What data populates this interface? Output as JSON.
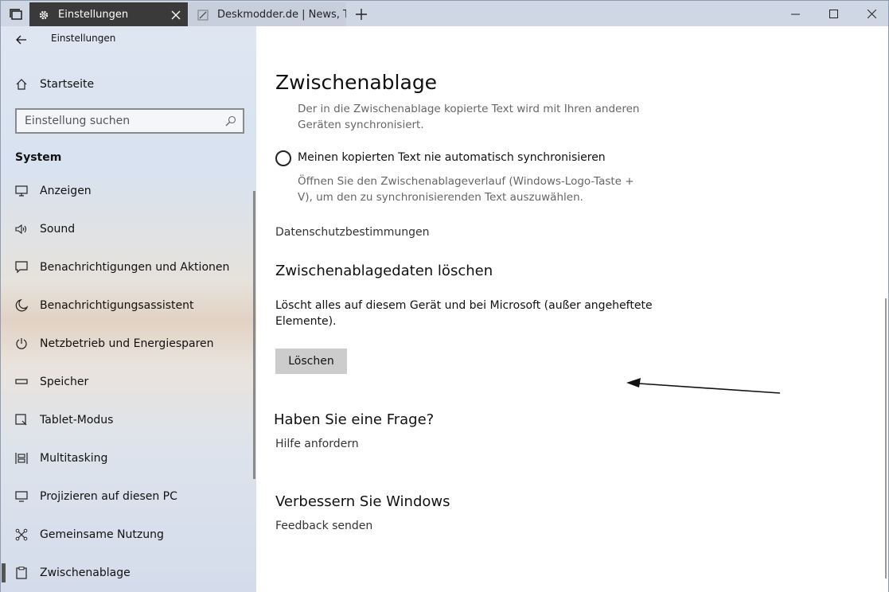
{
  "titlebar": {
    "active_tab": "Einstellungen",
    "inactive_tab": "Deskmodder.de | News, Tip",
    "icons": [
      "tab-overview-icon",
      "gear-icon",
      "close-icon",
      "pen-icon",
      "plus-icon",
      "minimize-icon",
      "maximize-icon",
      "close-window-icon"
    ]
  },
  "sidebar": {
    "app_title": "Einstellungen",
    "home_label": "Startseite",
    "search_placeholder": "Einstellung suchen",
    "section_title": "System",
    "items": [
      {
        "label": "Anzeigen",
        "icon": "monitor-icon"
      },
      {
        "label": "Sound",
        "icon": "speaker-icon"
      },
      {
        "label": "Benachrichtigungen und Aktionen",
        "icon": "notification-icon"
      },
      {
        "label": "Benachrichtigungsassistent",
        "icon": "moon-icon"
      },
      {
        "label": "Netzbetrieb und Energiesparen",
        "icon": "power-icon"
      },
      {
        "label": "Speicher",
        "icon": "storage-icon"
      },
      {
        "label": "Tablet-Modus",
        "icon": "tablet-icon"
      },
      {
        "label": "Multitasking",
        "icon": "multitasking-icon"
      },
      {
        "label": "Projizieren auf diesen PC",
        "icon": "project-icon"
      },
      {
        "label": "Gemeinsame Nutzung",
        "icon": "share-icon"
      },
      {
        "label": "Zwischenablage",
        "icon": "clipboard-icon"
      }
    ]
  },
  "main": {
    "title": "Zwischenablage",
    "sync_desc_line1": "Der in die Zwischenablage kopierte Text wird mit Ihren anderen",
    "sync_desc_line2": "Geräten synchronisiert.",
    "radio_label": "Meinen kopierten Text nie automatisch synchronisieren",
    "radio_desc_line1": "Öffnen Sie den Zwischenablageverlauf (Windows-Logo-Taste +",
    "radio_desc_line2": "V), um den zu synchronisierenden Text auszuwählen.",
    "privacy_link": "Datenschutzbestimmungen",
    "clear_heading": "Zwischenablagedaten löschen",
    "clear_desc_line1": "Löscht alles auf diesem Gerät und bei Microsoft (außer angeheftete",
    "clear_desc_line2": "Elemente).",
    "clear_button": "Löschen",
    "question_heading": "Haben Sie eine Frage?",
    "help_link": "Hilfe anfordern",
    "improve_heading": "Verbessern Sie Windows",
    "feedback_link": "Feedback senden"
  }
}
